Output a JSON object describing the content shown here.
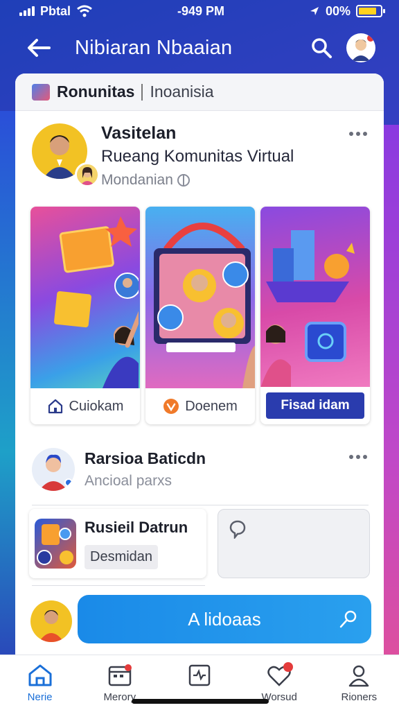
{
  "status_bar": {
    "carrier": "Pbtal",
    "time": "-949 PM",
    "battery": "00%",
    "battery_level": 0.82
  },
  "app_bar": {
    "title": "Nibiaran Nbaaian"
  },
  "community": {
    "name": "Ronunitas",
    "region": "Inoanisia"
  },
  "post": {
    "author": "Vasitelan",
    "group": "Rueang Komunitas Virtual",
    "meta": "Mondanian",
    "tiles": [
      {
        "label": "Cuiokam",
        "icon": "home-icon"
      },
      {
        "label": "Doenem",
        "icon": "badge-icon"
      },
      {
        "label": "Fisad idam",
        "icon": "none"
      }
    ]
  },
  "post2": {
    "name": "Rarsioa Baticdn",
    "meta": "Ancioal parxs"
  },
  "group_card": {
    "name": "Rusieil Datrun",
    "tag": "Desmidan"
  },
  "composer": {
    "label": "A lidoaas"
  },
  "bottom_nav": [
    {
      "label": "Nerie",
      "icon": "home-icon",
      "active": true
    },
    {
      "label": "Merory",
      "icon": "calendar-icon",
      "active": false
    },
    {
      "label": "",
      "icon": "activity-icon",
      "active": false
    },
    {
      "label": "Worsud",
      "icon": "heart-icon",
      "active": false
    },
    {
      "label": "Rioners",
      "icon": "person-icon",
      "active": false
    }
  ],
  "colors": {
    "primary": "#2a3cae",
    "accent": "#1a8ae8",
    "active_nav": "#1a6fd8",
    "notification": "#e43b3b"
  }
}
